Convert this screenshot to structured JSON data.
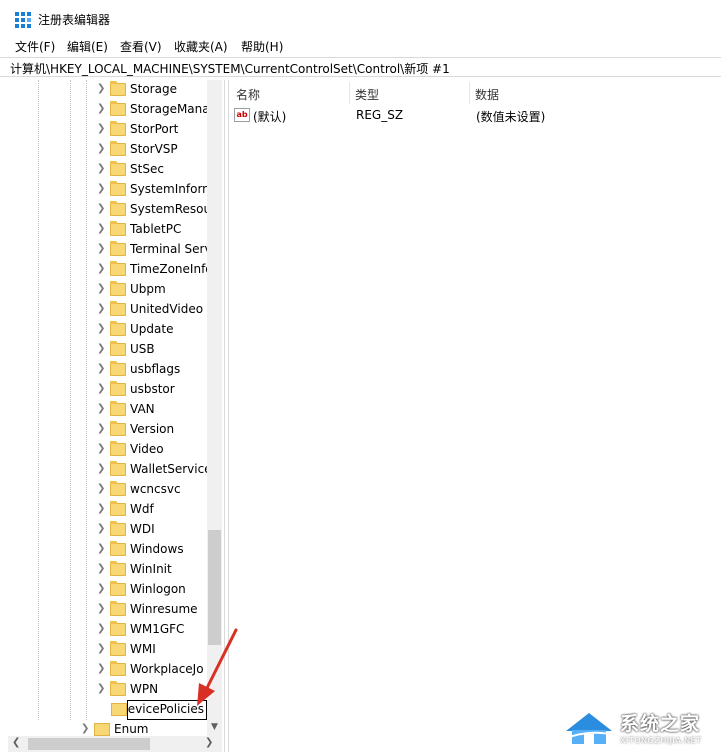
{
  "window": {
    "title": "注册表编辑器"
  },
  "menu": [
    "文件(F)",
    "编辑(E)",
    "查看(V)",
    "收藏夹(A)",
    "帮助(H)"
  ],
  "address": "计算机\\HKEY_LOCAL_MACHINE\\SYSTEM\\CurrentControlSet\\Control\\新项 #1",
  "tree": {
    "items": [
      "Storage",
      "StorageMana",
      "StorPort",
      "StorVSP",
      "StSec",
      "SystemInforn",
      "SystemResou",
      "TabletPC",
      "Terminal Serv",
      "TimeZoneInfo",
      "Ubpm",
      "UnitedVideo",
      "Update",
      "USB",
      "usbflags",
      "usbstor",
      "VAN",
      "Version",
      "Video",
      "WalletService",
      "wcncsvc",
      "Wdf",
      "WDI",
      "Windows",
      "WinInit",
      "Winlogon",
      "Winresume",
      "WM1GFC",
      "WMI",
      "WorkplaceJo",
      "WPN"
    ],
    "edit_value": "DevicePolicies",
    "enum_label": "Enum"
  },
  "list": {
    "headers": {
      "name": "名称",
      "type": "类型",
      "data": "数据"
    },
    "rows": [
      {
        "name": "(默认)",
        "type": "REG_SZ",
        "data": "(数值未设置)"
      }
    ],
    "value_icon_text": "ab"
  },
  "watermark": {
    "brand": "系统之家",
    "url": "XITONGZHIJIA.NET"
  },
  "colors": {
    "folder": "#f8d775",
    "arrow": "#d93025",
    "accent": "#1a7fd6"
  }
}
